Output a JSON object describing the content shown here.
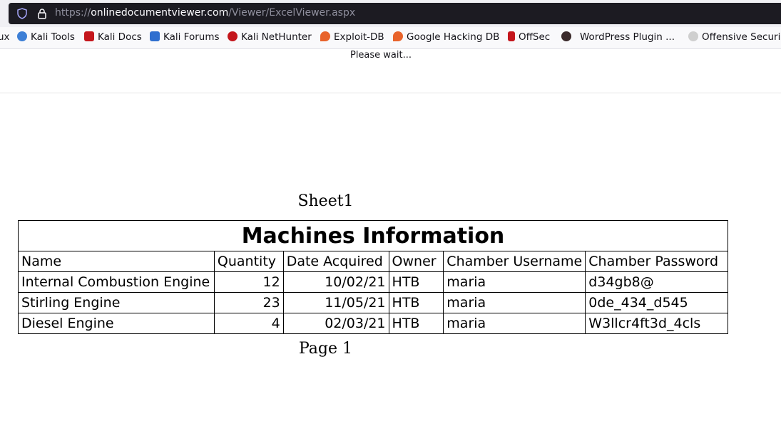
{
  "browser": {
    "url_prefix": "https://",
    "url_host": "onlinedocumentviewer.com",
    "url_path": "/Viewer/ExcelViewer.aspx",
    "bookmarks": [
      {
        "label": "ux",
        "icon": "kali-icon"
      },
      {
        "label": "Kali Tools",
        "icon": "kali-tools-icon"
      },
      {
        "label": "Kali Docs",
        "icon": "kali-docs-icon"
      },
      {
        "label": "Kali Forums",
        "icon": "kali-forums-icon"
      },
      {
        "label": "Kali NetHunter",
        "icon": "kali-nethunter-icon"
      },
      {
        "label": "Exploit-DB",
        "icon": "exploit-db-icon"
      },
      {
        "label": "Google Hacking DB",
        "icon": "ghdb-icon"
      },
      {
        "label": "OffSec",
        "icon": "offsec-icon"
      },
      {
        "label": "WordPress Plugin ...",
        "icon": "wordpress-plugin-icon"
      },
      {
        "label": "Offensive Securi",
        "icon": "offensive-security-icon"
      }
    ]
  },
  "page": {
    "wait_text": "Please wait...",
    "sheet_title": "Sheet1",
    "page_label": "Page 1"
  },
  "table": {
    "title": "Machines Information",
    "headers": [
      "Name",
      "Quantity",
      "Date Acquired",
      "Owner",
      "Chamber Username",
      "Chamber Password"
    ],
    "rows": [
      [
        "Internal Combustion Engine",
        "12",
        "10/02/21",
        "HTB",
        "maria",
        "d34gb8@"
      ],
      [
        "Stirling Engine",
        "23",
        "11/05/21",
        "HTB",
        "maria",
        "0de_434_d545"
      ],
      [
        "Diesel Engine",
        "4",
        "02/03/21",
        "HTB",
        "maria",
        "W3llcr4ft3d_4cls"
      ]
    ]
  }
}
